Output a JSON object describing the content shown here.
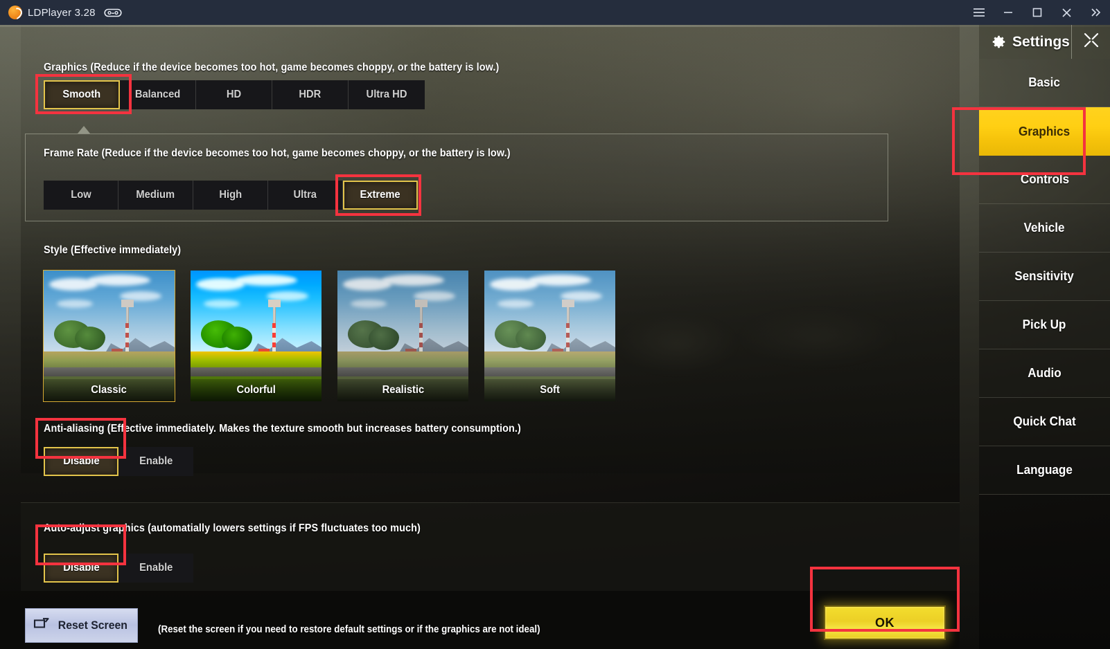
{
  "window": {
    "app_name": "LDPlayer 3.28",
    "logo_icon": "ldplayer-logo",
    "gamepad_icon": "gamepad-icon",
    "controls": [
      {
        "name": "menu-button",
        "icon": "hamburger-icon",
        "glyph": "☰"
      },
      {
        "name": "minimize-button",
        "icon": "minimize-icon",
        "glyph": "—"
      },
      {
        "name": "maximize-button",
        "icon": "maximize-icon",
        "glyph": "□"
      },
      {
        "name": "close-button",
        "icon": "close-icon",
        "glyph": "✕"
      },
      {
        "name": "expand-button",
        "icon": "chevron-double-right-icon",
        "glyph": "»"
      }
    ]
  },
  "sections": {
    "graphics": {
      "label": "Graphics (Reduce if the device becomes too hot, game becomes choppy, or the battery is low.)",
      "options": [
        "Smooth",
        "Balanced",
        "HD",
        "HDR",
        "Ultra HD"
      ],
      "selected": "Smooth"
    },
    "frame_rate": {
      "label": "Frame Rate (Reduce if the device becomes too hot, game becomes choppy, or the battery is low.)",
      "options": [
        "Low",
        "Medium",
        "High",
        "Ultra",
        "Extreme"
      ],
      "selected": "Extreme"
    },
    "style": {
      "label": "Style (Effective immediately)",
      "options": [
        "Classic",
        "Colorful",
        "Realistic",
        "Soft"
      ],
      "selected": "Classic"
    },
    "anti_aliasing": {
      "label": "Anti-aliasing (Effective immediately. Makes the texture smooth but increases battery consumption.)",
      "options": [
        "Disable",
        "Enable"
      ],
      "selected": "Disable"
    },
    "auto_adjust": {
      "label": "Auto-adjust graphics (automatially lowers settings if FPS fluctuates too much)",
      "options": [
        "Disable",
        "Enable"
      ],
      "selected": "Disable"
    }
  },
  "footer": {
    "reset_label": "Reset Screen",
    "reset_icon": "reset-screen-icon",
    "hint": "(Reset the screen if you need to restore default settings or if the graphics are not ideal)",
    "ok_label": "OK"
  },
  "sidebar": {
    "title": "Settings",
    "gear_icon": "gear-icon",
    "close_icon": "close-x-icon",
    "items": [
      {
        "label": "Basic",
        "active": false
      },
      {
        "label": "Graphics",
        "active": true
      },
      {
        "label": "Controls",
        "active": false
      },
      {
        "label": "Vehicle",
        "active": false
      },
      {
        "label": "Sensitivity",
        "active": false
      },
      {
        "label": "Pick Up",
        "active": false
      },
      {
        "label": "Audio",
        "active": false
      },
      {
        "label": "Quick Chat",
        "active": false
      },
      {
        "label": "Language",
        "active": false
      }
    ]
  },
  "colors": {
    "annotation": "#f4333f",
    "accent_yellow": "#ffd21e",
    "selected_border": "#e3c44b",
    "titlebar": "#252d3d"
  }
}
